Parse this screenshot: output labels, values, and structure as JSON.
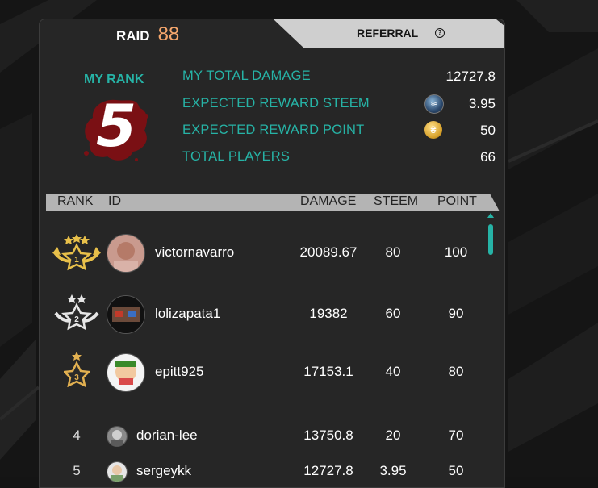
{
  "tabs": {
    "raid_label": "RAID",
    "raid_count": "88",
    "referral_label": "REFERRAL",
    "help_icon": "?"
  },
  "my_rank": {
    "label": "MY RANK",
    "value": "5"
  },
  "stats": [
    {
      "label": "MY TOTAL DAMAGE",
      "value": "12727.8",
      "icon": ""
    },
    {
      "label": "EXPECTED REWARD STEEM",
      "value": "3.95",
      "icon": "steem-coin-icon"
    },
    {
      "label": "EXPECTED REWARD POINT",
      "value": "50",
      "icon": "point-coin-icon"
    },
    {
      "label": "TOTAL PLAYERS",
      "value": "66",
      "icon": ""
    }
  ],
  "table": {
    "headers": {
      "rank": "RANK",
      "id": "ID",
      "damage": "DAMAGE",
      "steem": "STEEM",
      "point": "POINT"
    },
    "rows": [
      {
        "rank": "1",
        "badge": "gold-three-star-badge-icon",
        "id": "victornavarro",
        "damage": "20089.67",
        "steem": "80",
        "point": "100"
      },
      {
        "rank": "2",
        "badge": "silver-two-star-badge-icon",
        "id": "lolizapata1",
        "damage": "19382",
        "steem": "60",
        "point": "90"
      },
      {
        "rank": "3",
        "badge": "bronze-one-star-badge-icon",
        "id": "epitt925",
        "damage": "17153.1",
        "steem": "40",
        "point": "80"
      },
      {
        "rank": "4",
        "badge": "",
        "id": "dorian-lee",
        "damage": "13750.8",
        "steem": "20",
        "point": "70"
      },
      {
        "rank": "5",
        "badge": "",
        "id": "sergeykk",
        "damage": "12727.8",
        "steem": "3.95",
        "point": "50"
      }
    ]
  },
  "colors": {
    "accent": "#26b3a6",
    "raid_count": "#f5a66c",
    "gold": "#e8c04a",
    "panel": "#262626",
    "background": "#141414"
  }
}
